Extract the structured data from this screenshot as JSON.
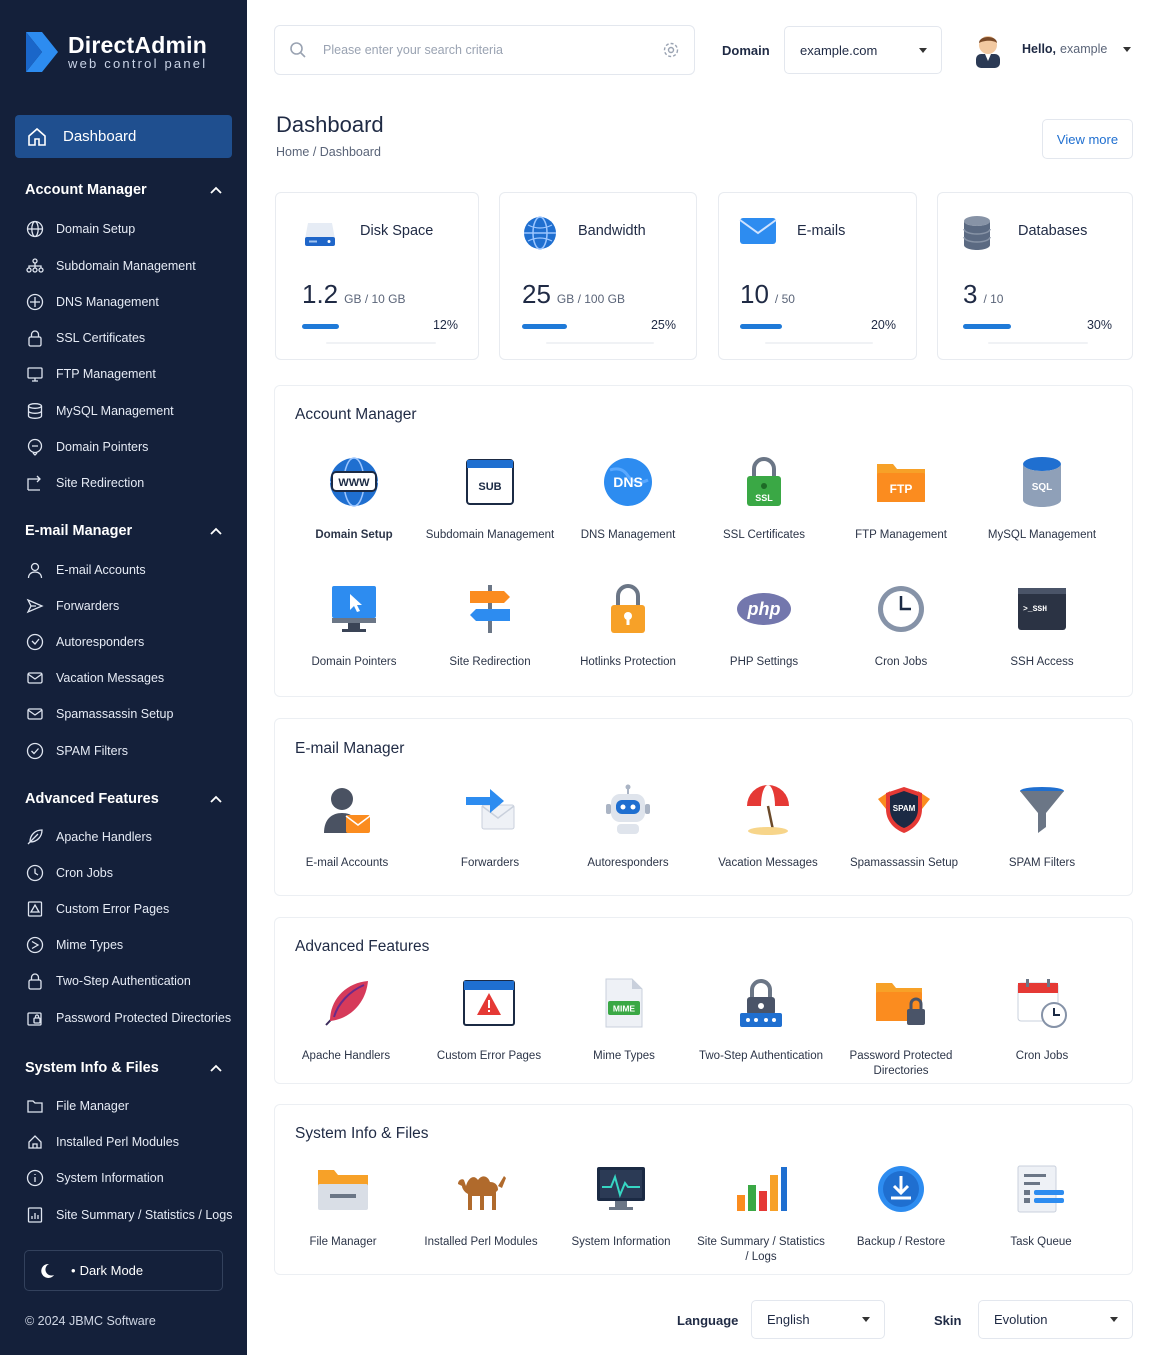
{
  "brand": {
    "title": "DirectAdmin",
    "subtitle": "web control panel"
  },
  "sidebar": {
    "dashboard": "Dashboard",
    "sections": [
      {
        "title": "Account Manager",
        "items": [
          "Domain Setup",
          "Subdomain Management",
          "DNS Management",
          "SSL Certificates",
          "FTP Management",
          "MySQL Management",
          "Domain Pointers",
          "Site Redirection"
        ]
      },
      {
        "title": "E-mail Manager",
        "items": [
          "E-mail Accounts",
          "Forwarders",
          "Autoresponders",
          "Vacation Messages",
          "Spamassassin Setup",
          "SPAM Filters"
        ]
      },
      {
        "title": "Advanced Features",
        "items": [
          "Apache Handlers",
          "Cron Jobs",
          "Custom Error Pages",
          "Mime Types",
          "Two-Step Authentication",
          "Password Protected Directories"
        ]
      },
      {
        "title": "System Info & Files",
        "items": [
          "File Manager",
          "Installed Perl Modules",
          "System Information",
          "Site Summary / Statistics / Logs"
        ]
      }
    ],
    "dark_mode": "Dark Mode",
    "copyright": "© 2024 JBMC Software"
  },
  "header": {
    "search_placeholder": "Please enter your search criteria",
    "domain_label": "Domain",
    "domain_value": "example.com",
    "hello": "Hello,",
    "username": "example"
  },
  "page": {
    "title": "Dashboard",
    "breadcrumb": "Home / Dashboard",
    "view_more": "View more"
  },
  "stats": [
    {
      "title": "Disk Space",
      "value": "1.2",
      "unit": "GB / 10 GB",
      "percent": "12%",
      "fraction": 0.12
    },
    {
      "title": "Bandwidth",
      "value": "25",
      "unit": "GB / 100 GB",
      "percent": "25%",
      "fraction": 0.25
    },
    {
      "title": "E-mails",
      "value": "10",
      "unit": "/ 50",
      "percent": "20%",
      "fraction": 0.2
    },
    {
      "title": "Databases",
      "value": "3",
      "unit": "/ 10",
      "percent": "30%",
      "fraction": 0.3
    }
  ],
  "panels": {
    "account": {
      "title": "Account Manager",
      "tiles": [
        "Domain Setup",
        "Subdomain Management",
        "DNS Management",
        "SSL Certificates",
        "FTP Management",
        "MySQL Management",
        "Domain Pointers",
        "Site Redirection",
        "Hotlinks Protection",
        "PHP Settings",
        "Cron Jobs",
        "SSH Access"
      ]
    },
    "email": {
      "title": "E-mail Manager",
      "tiles": [
        "E-mail Accounts",
        "Forwarders",
        "Autoresponders",
        "Vacation Messages",
        "Spamassassin Setup",
        "SPAM Filters"
      ]
    },
    "advanced": {
      "title": "Advanced Features",
      "tiles": [
        "Apache Handlers",
        "Custom Error Pages",
        "Mime Types",
        "Two-Step Authentication",
        "Password Protected Directories",
        "Cron Jobs"
      ]
    },
    "system": {
      "title": "System Info & Files",
      "tiles": [
        "File Manager",
        "Installed Perl Modules",
        "System Information",
        "Site Summary / Statistics / Logs",
        "Backup / Restore",
        "Task Queue"
      ]
    }
  },
  "icon_text": {
    "www": "WWW",
    "sub": "SUB",
    "dns": "DNS",
    "ssl": "SSL",
    "ftp": "FTP",
    "sql": "SQL",
    "php": "php",
    "ssh": ">_SSH",
    "spam": "SPAM",
    "mime": "MIME"
  },
  "footer": {
    "language_label": "Language",
    "language_value": "English",
    "skin_label": "Skin",
    "skin_value": "Evolution"
  },
  "colors": {
    "sidebar_bg": "#14203a",
    "active_bg": "#1f4f8f",
    "accent": "#1f7ad8"
  }
}
